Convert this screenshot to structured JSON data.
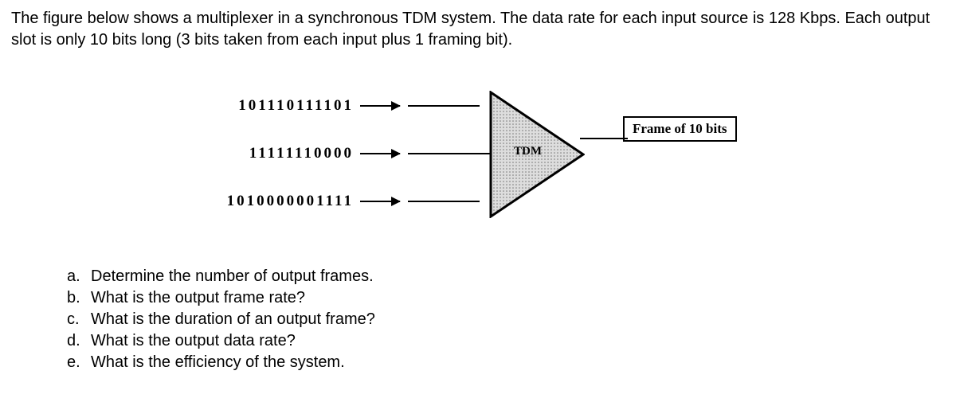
{
  "intro": "The figure below shows a multiplexer in a synchronous TDM system. The data rate for each input source is 128 Kbps. Each output slot is only 10 bits long (3 bits taken from each input plus 1 framing bit).",
  "inputs": {
    "line1": "101110111101",
    "line2": "11111110000",
    "line3": "1010000001111"
  },
  "mux_label": "TDM",
  "frame_label": "Frame of 10 bits",
  "questions": [
    {
      "marker": "a.",
      "text": "Determine the number of output frames."
    },
    {
      "marker": "b.",
      "text": "What is the output frame rate?"
    },
    {
      "marker": "c.",
      "text": "What is the duration of an output frame?"
    },
    {
      "marker": "d.",
      "text": "What is the output data rate?"
    },
    {
      "marker": "e.",
      "text": "What is the efficiency of the system."
    }
  ]
}
